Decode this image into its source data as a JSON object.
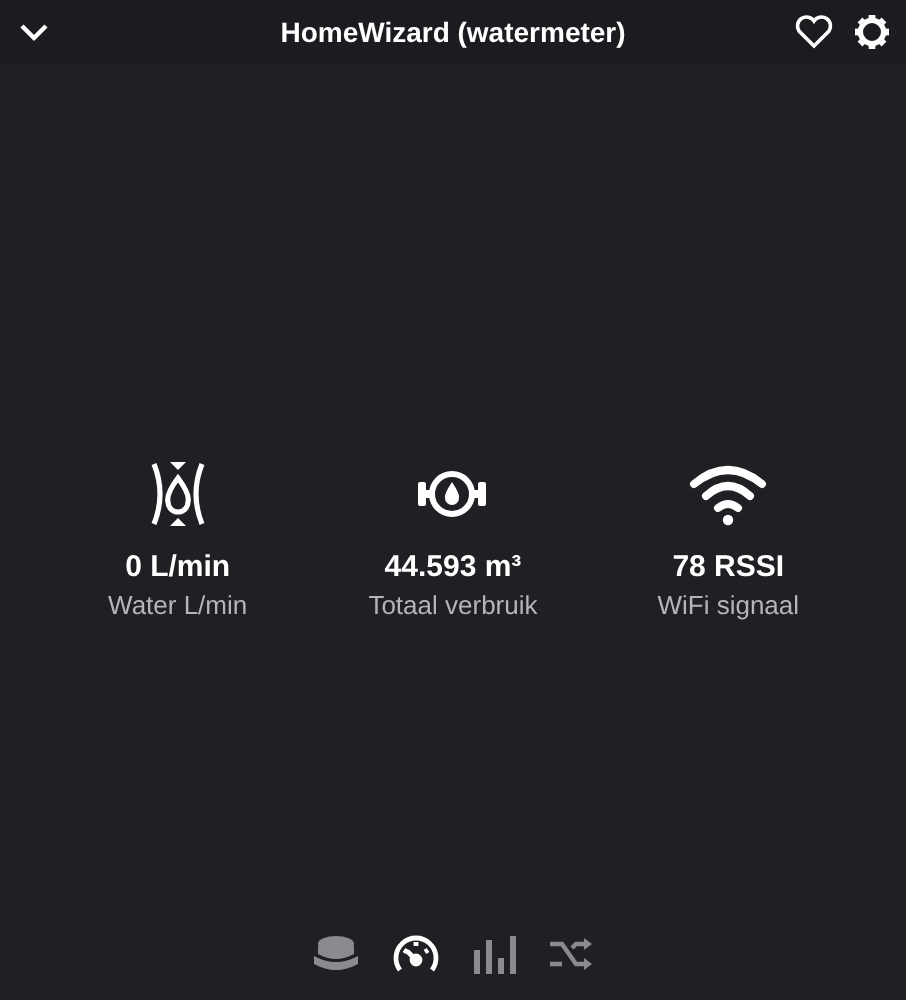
{
  "header": {
    "title": "HomeWizard (watermeter)"
  },
  "tiles": [
    {
      "kind": "flow",
      "value": "0 L/min",
      "label": "Water L/min"
    },
    {
      "kind": "meter",
      "value": "44.593 m³",
      "label": "Totaal verbruik"
    },
    {
      "kind": "wifi",
      "value": "78 RSSI",
      "label": "WiFi signaal"
    }
  ],
  "nav": [
    {
      "kind": "button",
      "selected": false
    },
    {
      "kind": "gauge",
      "selected": true
    },
    {
      "kind": "bars",
      "selected": false
    },
    {
      "kind": "shuffle",
      "selected": false
    }
  ]
}
